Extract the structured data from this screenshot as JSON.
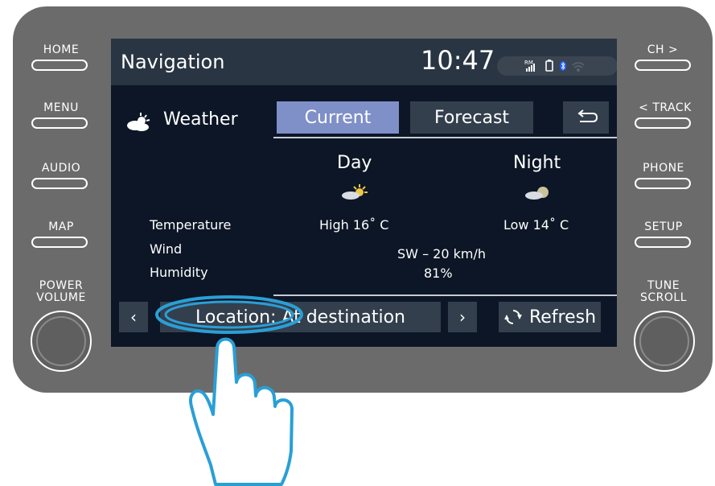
{
  "hardware": {
    "left_buttons": [
      "HOME",
      "MENU",
      "AUDIO",
      "MAP"
    ],
    "right_buttons": [
      "CH >",
      "< TRACK",
      "PHONE",
      "SETUP"
    ],
    "left_knob_label": [
      "POWER",
      "VOLUME"
    ],
    "right_knob_label": [
      "TUNE",
      "SCROLL"
    ]
  },
  "header": {
    "title": "Navigation",
    "clock": "10:47",
    "status_rm": "RM"
  },
  "weather": {
    "title": "Weather",
    "tabs": [
      "Current",
      "Forecast"
    ],
    "active_tab": "Current",
    "columns": {
      "day": "Day",
      "night": "Night"
    },
    "rows": {
      "temperature": "Temperature",
      "wind": "Wind",
      "humidity": "Humidity"
    },
    "day_temperature": "High 16˚ C",
    "night_temperature": "Low 14˚ C",
    "wind_value": "SW – 20 km/h",
    "humidity_value": "81%"
  },
  "footer": {
    "location_label": "Location: At destination",
    "refresh_label": "Refresh",
    "prev_symbol": "‹",
    "next_symbol": "›"
  },
  "colors": {
    "bezel": "#6b6b6b",
    "screen_bg": "#0c1626",
    "topbar": "#293542",
    "tab_active": "#7f8fc8",
    "tab_inactive": "#333f4d",
    "highlight": "#2a9fd6"
  }
}
